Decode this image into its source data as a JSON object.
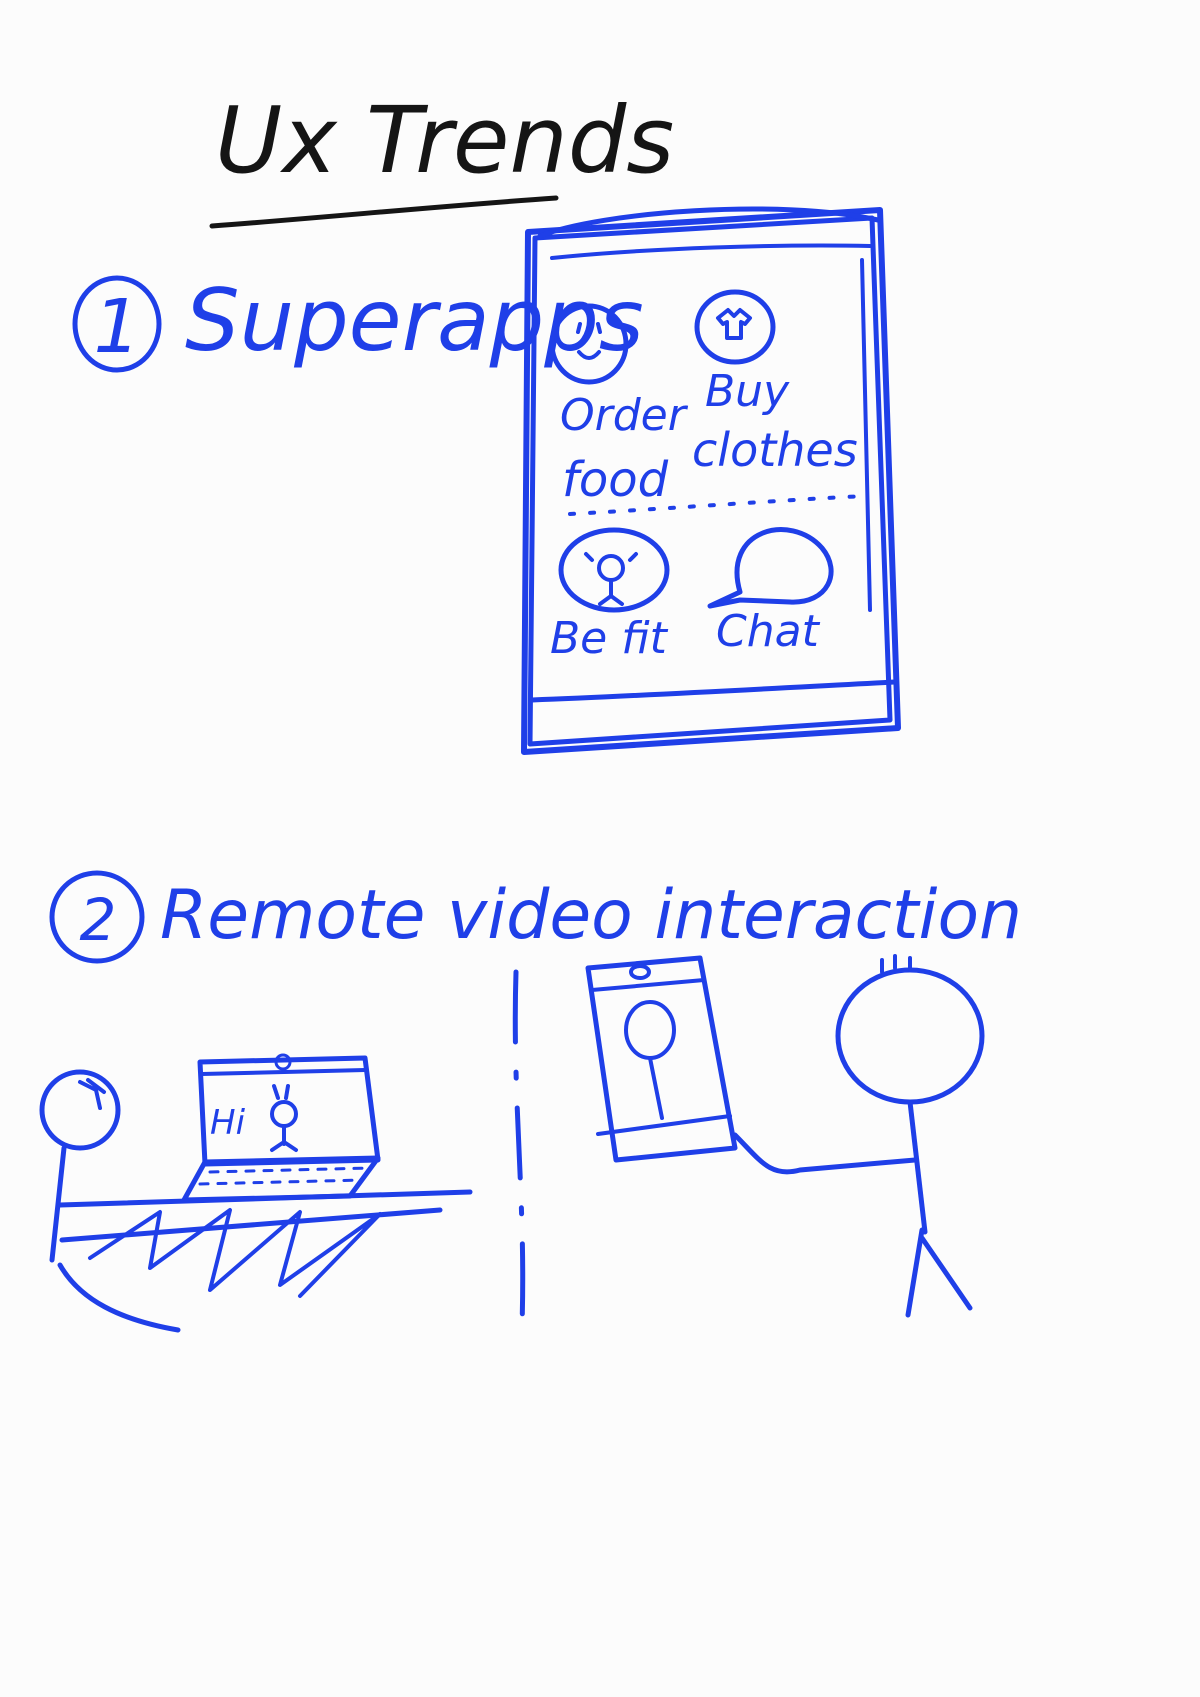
{
  "title": "Ux Trends",
  "colors": {
    "ink_blue": "#1f3fe8",
    "ink_black": "#151515",
    "paper": "#fcfcfc"
  },
  "section1": {
    "number": "1",
    "heading": "Superapps",
    "apps": [
      {
        "label_line1": "Order",
        "label_line2": "food",
        "icon": "food-face-icon"
      },
      {
        "label_line1": "Buy",
        "label_line2": "clothes",
        "icon": "tshirt-icon"
      },
      {
        "label_line1": "Be fit",
        "label_line2": "",
        "icon": "fitness-person-icon"
      },
      {
        "label_line1": "Chat",
        "label_line2": "",
        "icon": "chat-bubble-icon"
      }
    ]
  },
  "section2": {
    "number": "2",
    "heading": "Remote video interaction",
    "laptop_greeting": "Hi"
  }
}
